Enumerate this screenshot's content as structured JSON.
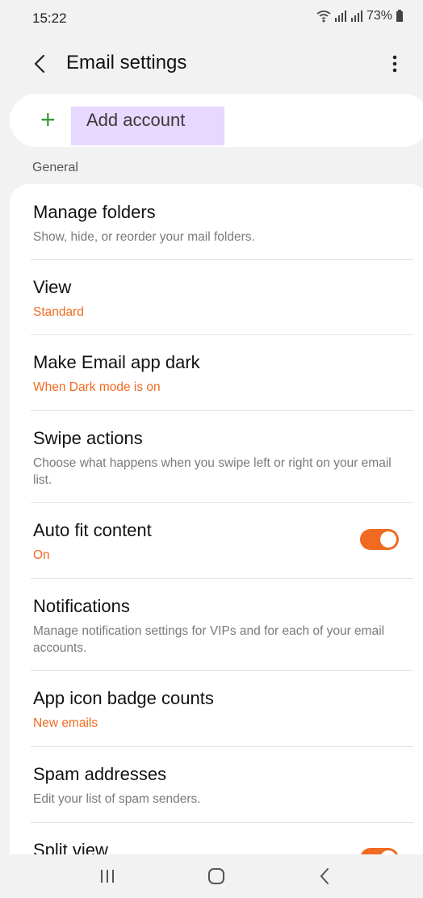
{
  "status_bar": {
    "time": "15:22",
    "battery": "73%"
  },
  "header": {
    "title": "Email settings"
  },
  "add_account": {
    "label": "Add account"
  },
  "section": {
    "general": "General"
  },
  "items": [
    {
      "title": "Manage folders",
      "subtitle": "Show, hide, or reorder your mail folders."
    },
    {
      "title": "View",
      "subtitle": "Standard"
    },
    {
      "title": "Make Email app dark",
      "subtitle": "When Dark mode is on"
    },
    {
      "title": "Swipe actions",
      "subtitle": "Choose what happens when you swipe left or right on your email list."
    },
    {
      "title": "Auto fit content",
      "subtitle": "On",
      "toggle_on": true
    },
    {
      "title": "Notifications",
      "subtitle": "Manage notification settings for VIPs and for each of your email accounts."
    },
    {
      "title": "App icon badge counts",
      "subtitle": "New emails"
    },
    {
      "title": "Spam addresses",
      "subtitle": "Edit your list of spam senders."
    },
    {
      "title": "Split view",
      "toggle_on": true
    }
  ],
  "colors": {
    "accent": "#f06a21",
    "plus": "#3a9b37",
    "highlight": "#e7d8ff"
  }
}
